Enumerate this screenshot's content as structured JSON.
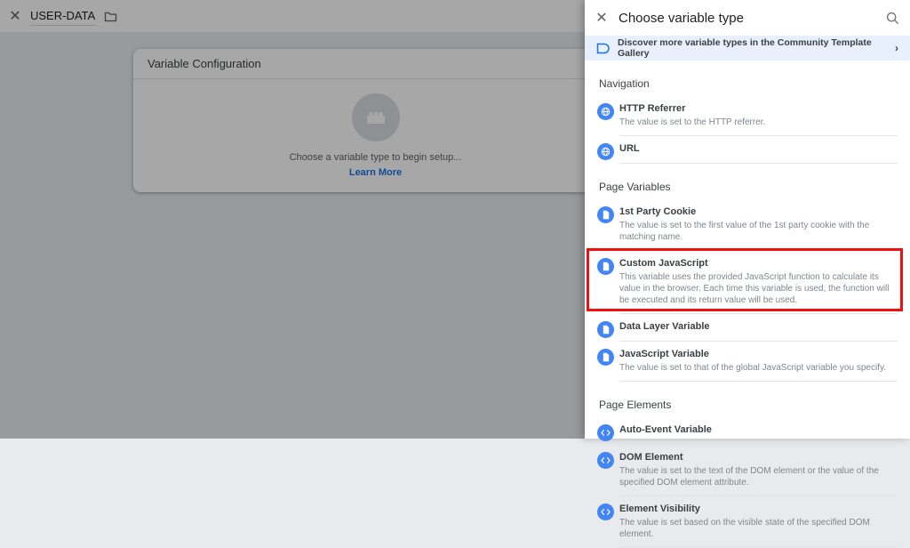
{
  "colors": {
    "accent_blue": "#4285f4",
    "link_blue": "#1a73e8",
    "banner_bg": "#e8f0fe",
    "highlight_red": "#ee1111"
  },
  "editor": {
    "close_label": "✕",
    "workspace_title": "USER-DATA",
    "card": {
      "header": "Variable Configuration",
      "placeholder_text": "Choose a variable type to begin setup...",
      "learn_more_label": "Learn More"
    }
  },
  "panel": {
    "close_label": "✕",
    "title": "Choose variable type",
    "banner": {
      "text": "Discover more variable types in the Community Template Gallery",
      "chevron": "›"
    },
    "sections": [
      {
        "header": "Navigation",
        "items": [
          {
            "title": "HTTP Referrer",
            "desc": "The value is set to the HTTP referrer."
          },
          {
            "title": "URL",
            "desc": ""
          }
        ]
      },
      {
        "header": "Page Variables",
        "items": [
          {
            "title": "1st Party Cookie",
            "desc": "The value is set to the first value of the 1st party cookie with the matching name."
          },
          {
            "title": "Custom JavaScript",
            "desc": "This variable uses the provided JavaScript function to calculate its value in the browser. Each time this variable is used, the function will be executed and its return value will be used.",
            "highlighted": true
          },
          {
            "title": "Data Layer Variable",
            "desc": ""
          },
          {
            "title": "JavaScript Variable",
            "desc": "The value is set to that of the global JavaScript variable you specify."
          }
        ]
      },
      {
        "header": "Page Elements",
        "items": [
          {
            "title": "Auto-Event Variable",
            "desc": ""
          },
          {
            "title": "DOM Element",
            "desc": "The value is set to the text of the DOM element or the value of the specified DOM element attribute."
          },
          {
            "title": "Element Visibility",
            "desc": "The value is set based on the visible state of the specified DOM element."
          }
        ]
      }
    ]
  }
}
